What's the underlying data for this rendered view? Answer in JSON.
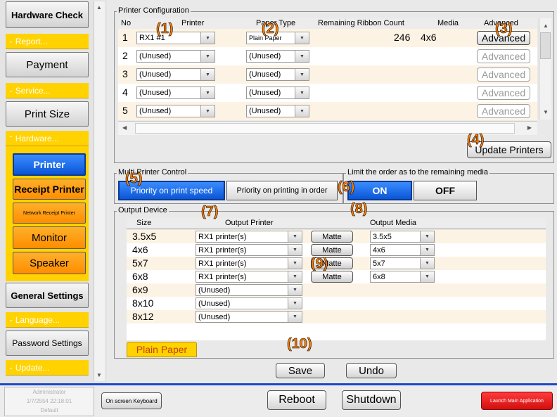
{
  "sidebar": {
    "hardware_check": "Hardware Check",
    "report": "Report...",
    "payment": "Payment",
    "service": "Service...",
    "print_size": "Print Size",
    "hardware": "Hardware...",
    "printer": "Printer",
    "receipt_printer": "Receipt Printer",
    "network_receipt_printer": "Network Receipt Printer",
    "monitor": "Monitor",
    "speaker": "Speaker",
    "general_settings": "General Settings",
    "language": "Language...",
    "password_settings": "Password Settings",
    "update": "Update..."
  },
  "printer_config": {
    "title": "Printer Configuration",
    "columns": {
      "no": "No",
      "printer": "Printer",
      "paper_type": "Paper Type",
      "remaining": "Remaining Ribbon Count",
      "media": "Media",
      "advanced": "Advanced"
    },
    "rows": [
      {
        "no": "1",
        "printer": "RX1 #1",
        "paper": "Plain Paper",
        "remaining": "246",
        "media": "4x6",
        "advanced": "Advanced"
      },
      {
        "no": "2",
        "printer": "(Unused)",
        "paper": "(Unused)",
        "remaining": "",
        "media": "",
        "advanced": "Advanced"
      },
      {
        "no": "3",
        "printer": "(Unused)",
        "paper": "(Unused)",
        "remaining": "",
        "media": "",
        "advanced": "Advanced"
      },
      {
        "no": "4",
        "printer": "(Unused)",
        "paper": "(Unused)",
        "remaining": "",
        "media": "",
        "advanced": "Advanced"
      },
      {
        "no": "5",
        "printer": "(Unused)",
        "paper": "(Unused)",
        "remaining": "",
        "media": "",
        "advanced": "Advanced"
      }
    ],
    "update_printers": "Update Printers"
  },
  "multi_printer": {
    "title": "Multi Printer Control",
    "speed": "Priority on print speed",
    "order": "Priority on printing in order"
  },
  "limit_order": {
    "title": "Limit the order as to the remaining media",
    "on": "ON",
    "off": "OFF"
  },
  "output_device": {
    "title": "Output Device",
    "columns": {
      "size": "Size",
      "printer": "Output Printer",
      "media": "Output Media"
    },
    "rows": [
      {
        "size": "3.5x5",
        "printer": "RX1 printer(s)",
        "matte": "Matte",
        "media": "3.5x5"
      },
      {
        "size": "4x6",
        "printer": "RX1 printer(s)",
        "matte": "Matte",
        "media": "4x6"
      },
      {
        "size": "5x7",
        "printer": "RX1 printer(s)",
        "matte": "Matte",
        "media": "5x7"
      },
      {
        "size": "6x8",
        "printer": "RX1 printer(s)",
        "matte": "Matte",
        "media": "6x8"
      },
      {
        "size": "6x9",
        "printer": "(Unused)",
        "matte": "",
        "media": ""
      },
      {
        "size": "8x10",
        "printer": "(Unused)",
        "matte": "",
        "media": ""
      },
      {
        "size": "8x12",
        "printer": "(Unused)",
        "matte": "",
        "media": ""
      }
    ],
    "tab": "Plain Paper"
  },
  "actions": {
    "save": "Save",
    "undo": "Undo"
  },
  "bottom": {
    "user": "Administrator",
    "datetime": "1/7/2554 22:18:01",
    "profile": "Default",
    "keyboard": "On screen Keyboard",
    "reboot": "Reboot",
    "shutdown": "Shutdown",
    "launch": "Launch Main Application"
  },
  "annotations": [
    "(1)",
    "(2)",
    "(3)",
    "(4)",
    "(5)",
    "(6)",
    "(7)",
    "(8)",
    "(9)",
    "(10)"
  ],
  "colors": {
    "accent_yellow": "#ffd200",
    "selected_blue": "#0a55d6",
    "orange_button": "#ff9a10",
    "annotation_orange": "#ff7f00",
    "launch_red": "#e8161b",
    "row_tint": "#fdf3e4"
  }
}
